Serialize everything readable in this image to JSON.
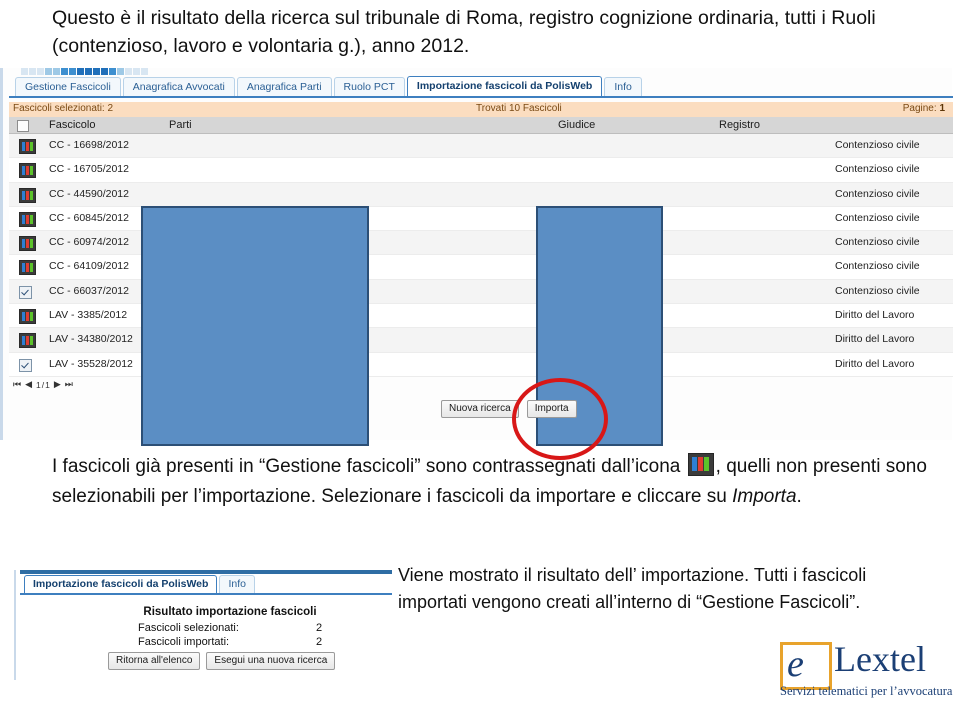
{
  "caption_top": "Questo è il risultato della ricerca sul tribunale di Roma, registro cognizione ordinaria, tutti i Ruoli (contenzioso, lavoro e volontaria g.), anno 2012.",
  "app_window": {
    "tabs": [
      {
        "label": "Gestione Fascicoli",
        "active": false
      },
      {
        "label": "Anagrafica Avvocati",
        "active": false
      },
      {
        "label": "Anagrafica Parti",
        "active": false
      },
      {
        "label": "Ruolo PCT",
        "active": false
      },
      {
        "label": "Importazione fascicoli da PolisWeb",
        "active": true
      },
      {
        "label": "Info",
        "active": false
      }
    ],
    "info_bar": {
      "selected": "Fascicoli selezionati: 2",
      "found": "Trovati 10 Fascicoli",
      "pages_label": "Pagine:",
      "pages_value": "1"
    },
    "columns": [
      "Fascicolo",
      "Parti",
      "Giudice",
      "Registro"
    ],
    "rows": [
      {
        "fascicolo": "CC - 16698/2012",
        "registro": "Contenzioso civile",
        "mark": "binder-icon",
        "checked": false
      },
      {
        "fascicolo": "CC - 16705/2012",
        "registro": "Contenzioso civile",
        "mark": "binder-icon",
        "checked": false
      },
      {
        "fascicolo": "CC - 44590/2012",
        "registro": "Contenzioso civile",
        "mark": "binder-icon",
        "checked": false
      },
      {
        "fascicolo": "CC - 60845/2012",
        "registro": "Contenzioso civile",
        "mark": "binder-icon",
        "checked": false
      },
      {
        "fascicolo": "CC - 60974/2012",
        "registro": "Contenzioso civile",
        "mark": "binder-icon",
        "checked": false
      },
      {
        "fascicolo": "CC - 64109/2012",
        "registro": "Contenzioso civile",
        "mark": "binder-icon",
        "checked": false
      },
      {
        "fascicolo": "CC - 66037/2012",
        "registro": "Contenzioso civile",
        "mark": "checkbox",
        "checked": true
      },
      {
        "fascicolo": "LAV - 3385/2012",
        "registro": "Diritto del Lavoro",
        "mark": "binder-icon",
        "checked": false
      },
      {
        "fascicolo": "LAV - 34380/2012",
        "registro": "Diritto del Lavoro",
        "mark": "binder-icon",
        "checked": false
      },
      {
        "fascicolo": "LAV - 35528/2012",
        "registro": "Diritto del Lavoro",
        "mark": "checkbox",
        "checked": true
      }
    ],
    "pager": {
      "first": "⏮",
      "prev": "◀",
      "page": "1/1",
      "next": "▶",
      "last": "⏭"
    },
    "buttons": {
      "new_search": "Nuova ricerca",
      "import": "Importa"
    },
    "annotation_color": "#d81717"
  },
  "paragraph_middle": {
    "part1": "I fascicoli già presenti in “Gestione fascicoli” sono contrassegnati dall’icona",
    "part2": ", quelli non presenti sono selezionabili per l’importazione. Selezionare i fascicoli da importare e cliccare su ",
    "emphasis": "Importa",
    "part3": "."
  },
  "result_window": {
    "tabs": [
      {
        "label": "Importazione fascicoli da PolisWeb",
        "active": true
      },
      {
        "label": "Info",
        "active": false
      }
    ],
    "title": "Risultato importazione fascicoli",
    "lines": [
      {
        "label": "Fascicoli selezionati:",
        "value": "2"
      },
      {
        "label": "Fascicoli importati:",
        "value": "2"
      }
    ],
    "buttons": {
      "back": "Ritorna all'elenco",
      "new_search": "Esegui una nuova ricerca"
    }
  },
  "paragraph_bottom_right": "Viene mostrato il risultato dell’ importazione. Tutti i fascicoli importati vengono creati all’interno di “Gestione Fascicoli”.",
  "logo": {
    "mark_letter": "e",
    "word": "Lextel",
    "tagline": "Servizi telematici per l’avvocatura",
    "brand_color": "#1b3f75",
    "accent_color": "#e8a32c"
  }
}
